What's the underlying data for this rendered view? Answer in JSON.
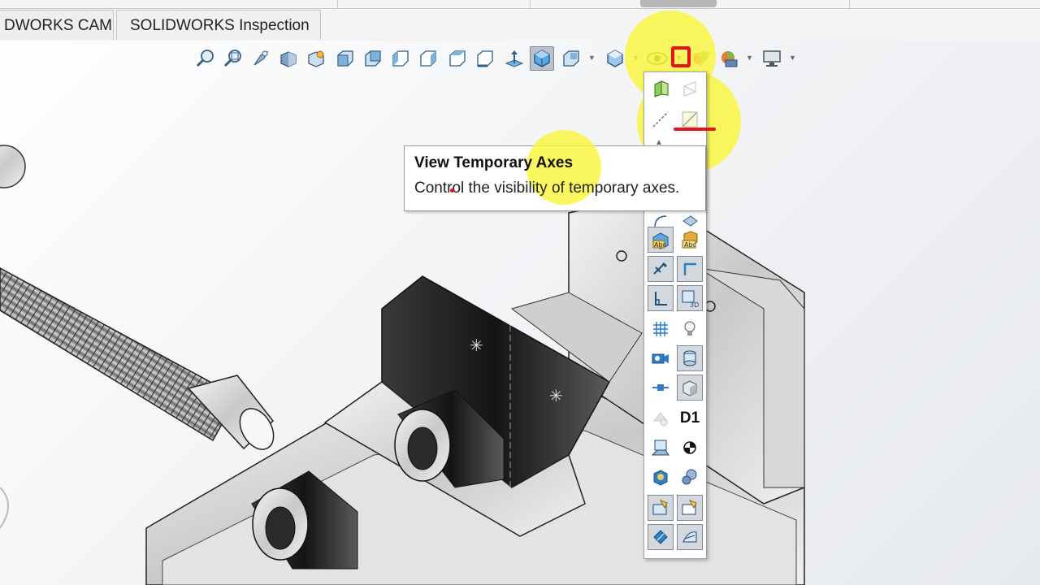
{
  "tabs": [
    {
      "label": "DWORKS CAM"
    },
    {
      "label": "SOLIDWORKS Inspection"
    }
  ],
  "tooltip": {
    "title": "View Temporary Axes",
    "description": "Control the visibility of temporary axes."
  },
  "flyout": {
    "dimension_label": "D1"
  },
  "colors": {
    "highlight": "#faf53c",
    "annotation_red": "#e8101a",
    "toolbar_active": "#b9c2cc"
  },
  "hud_icons": [
    "zoom-to-fit-icon",
    "zoom-area-icon",
    "previous-view-icon",
    "section-view-icon",
    "dynamic-annotation-icon",
    "view-front-icon",
    "view-back-icon",
    "view-left-icon",
    "view-right-icon",
    "view-top-icon",
    "view-bottom-icon",
    "normal-to-icon",
    "isometric-icon",
    "view-orientation-icon",
    "display-style-icon",
    "hide-show-items-icon",
    "edit-appearance-icon",
    "apply-scene-icon",
    "view-settings-icon"
  ]
}
